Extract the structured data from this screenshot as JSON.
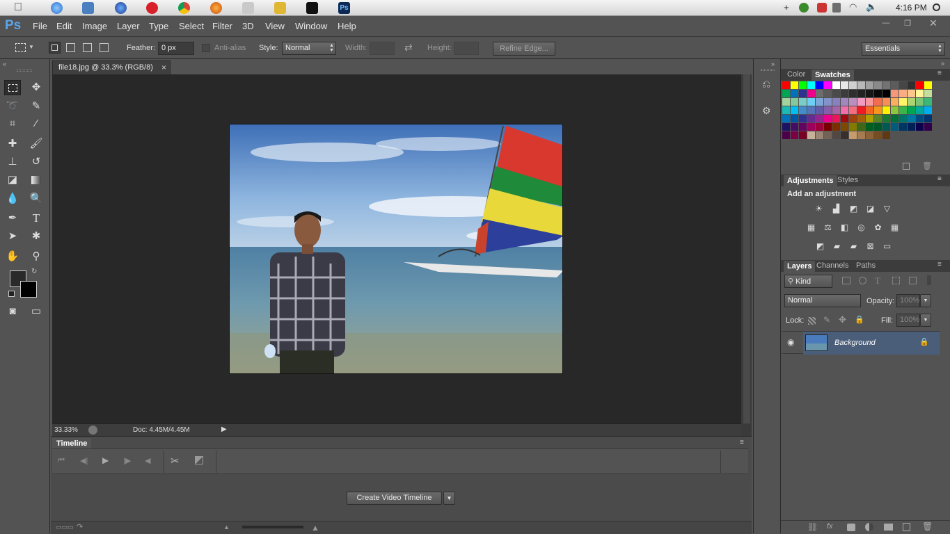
{
  "system_bar": {
    "clock": "4:16 PM",
    "tray_icons": [
      "plus-icon",
      "network-globe-icon",
      "no-entry-icon",
      "wifi-icon",
      "volume-icon",
      "search-circle-icon"
    ]
  },
  "app": {
    "logo": "Ps",
    "menus": [
      "File",
      "Edit",
      "Image",
      "Layer",
      "Type",
      "Select",
      "Filter",
      "3D",
      "View",
      "Window",
      "Help"
    ]
  },
  "options": {
    "feather_label": "Feather:",
    "feather_value": "0 px",
    "antialias_label": "Anti-alias",
    "style_label": "Style:",
    "style_value": "Normal",
    "width_label": "Width:",
    "height_label": "Height:",
    "refine_edge": "Refine Edge...",
    "workspace": "Essentials"
  },
  "document": {
    "tab_title": "file18.jpg @ 33.3% (RGB/8)",
    "close_glyph": "×",
    "zoom": "33.33%",
    "doc_size": "Doc: 4.45M/4.45M"
  },
  "timeline": {
    "title": "Timeline",
    "create_button": "Create Video Timeline"
  },
  "panels": {
    "color_tab": "Color",
    "swatches_tab": "Swatches",
    "adjustments_tab": "Adjustments",
    "styles_tab": "Styles",
    "add_adjustment": "Add an adjustment",
    "layers_tab": "Layers",
    "channels_tab": "Channels",
    "paths_tab": "Paths",
    "kind_filter": "Kind",
    "blend_mode": "Normal",
    "opacity_label": "Opacity:",
    "opacity_value": "100%",
    "lock_label": "Lock:",
    "fill_label": "Fill:",
    "fill_value": "100%",
    "layer_name": "Background"
  },
  "colors": {
    "accent_blue": "#4a5d79",
    "foreground": "#2a2a2a",
    "background": "#000000"
  }
}
